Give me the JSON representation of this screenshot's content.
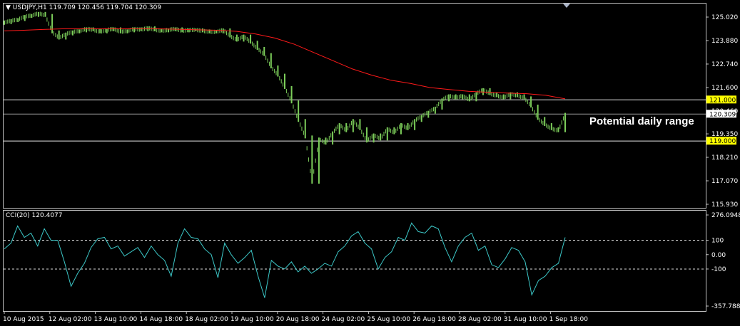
{
  "header": {
    "symbol": "USDJPY,H1",
    "ohlc": "119.709 120.456 119.704 120.309"
  },
  "annotation": "Potential daily range",
  "indicator": {
    "label": "CCI(20) 120.4077"
  },
  "colors": {
    "background": "#000000",
    "candles": "#7ccd5a",
    "ma": "#ff1a1a",
    "cci": "#3cc8c8",
    "level_tag": "#ffff00",
    "price_tag": "#ffffff"
  },
  "chart_data": [
    {
      "type": "line",
      "title": "USDJPY,H1",
      "ylim": [
        115.93,
        125.6
      ],
      "y_ticks": [
        "125.020",
        "123.880",
        "122.740",
        "121.600",
        "120.460",
        "119.350",
        "118.210",
        "117.070",
        "115.930"
      ],
      "x_tick_labels": [
        "10 Aug 2015",
        "12 Aug 02:00",
        "13 Aug 10:00",
        "14 Aug 18:00",
        "18 Aug 02:00",
        "19 Aug 10:00",
        "20 Aug 18:00",
        "24 Aug 02:00",
        "25 Aug 10:00",
        "26 Aug 18:00",
        "28 Aug 02:00",
        "31 Aug 10:00",
        "1 Sep 18:00"
      ],
      "series": [
        {
          "values": [
            124.75,
            124.85,
            124.9,
            125.05,
            125.1,
            125.2,
            125.1,
            124.3,
            124.0,
            124.2,
            124.3,
            124.35,
            124.45,
            124.4,
            124.3,
            124.4,
            124.45,
            124.3,
            124.35,
            124.45,
            124.4,
            124.5,
            124.4,
            124.35,
            124.4,
            124.45,
            124.35,
            124.4,
            124.4,
            124.35,
            124.3,
            124.3,
            124.4,
            124.1,
            123.9,
            124.1,
            123.8,
            123.5,
            123.2,
            122.6,
            122.2,
            121.6,
            120.9,
            120.0,
            119.2,
            117.0,
            119.1,
            118.9,
            119.4,
            119.8,
            119.5,
            120.0,
            119.6,
            119.0,
            119.3,
            119.1,
            119.6,
            119.4,
            119.8,
            119.6,
            120.0,
            120.2,
            120.4,
            120.6,
            121.0,
            121.2,
            121.1,
            121.2,
            121.0,
            121.3,
            121.5,
            121.3,
            121.2,
            121.1,
            121.3,
            121.2,
            121.1,
            120.7,
            120.1,
            119.8,
            119.6,
            119.5,
            120.3
          ]
        },
        {
          "values": [
            124.35,
            124.38,
            124.42,
            124.45,
            124.45,
            124.45,
            124.45,
            124.45,
            124.45,
            124.43,
            124.4,
            124.38,
            124.33,
            124.2,
            124.0,
            123.7,
            123.3,
            122.9,
            122.5,
            122.2,
            121.95,
            121.8,
            121.6,
            121.5,
            121.42,
            121.37,
            121.33,
            121.3,
            121.22,
            121.05
          ]
        }
      ],
      "levels": [
        121.0,
        119.0
      ],
      "current_price": "120.309",
      "level_labels": [
        "121.000",
        "119.000"
      ]
    },
    {
      "type": "line",
      "title": "CCI(20) 120.4077",
      "ylim": [
        -357.7888,
        276.0948
      ],
      "y_ticks": [
        "276.0948",
        "100",
        "0.00",
        "-100",
        "-357.7888"
      ],
      "levels": [
        100,
        -100
      ],
      "series": [
        {
          "values": [
            40,
            80,
            200,
            120,
            150,
            60,
            180,
            100,
            100,
            -50,
            -220,
            -130,
            -60,
            50,
            110,
            120,
            40,
            60,
            -10,
            20,
            50,
            -20,
            60,
            0,
            -40,
            -150,
            80,
            180,
            120,
            110,
            40,
            0,
            -160,
            80,
            0,
            -60,
            -20,
            30,
            -150,
            -300,
            -40,
            -80,
            -100,
            -50,
            -120,
            -80,
            -130,
            -100,
            -60,
            -80,
            20,
            60,
            130,
            160,
            80,
            40,
            -100,
            -20,
            20,
            120,
            100,
            220,
            160,
            150,
            200,
            180,
            50,
            -50,
            60,
            120,
            150,
            30,
            60,
            -70,
            -90,
            -30,
            50,
            30,
            -50,
            -280,
            -180,
            -150,
            -90,
            -60,
            120
          ]
        }
      ]
    }
  ]
}
